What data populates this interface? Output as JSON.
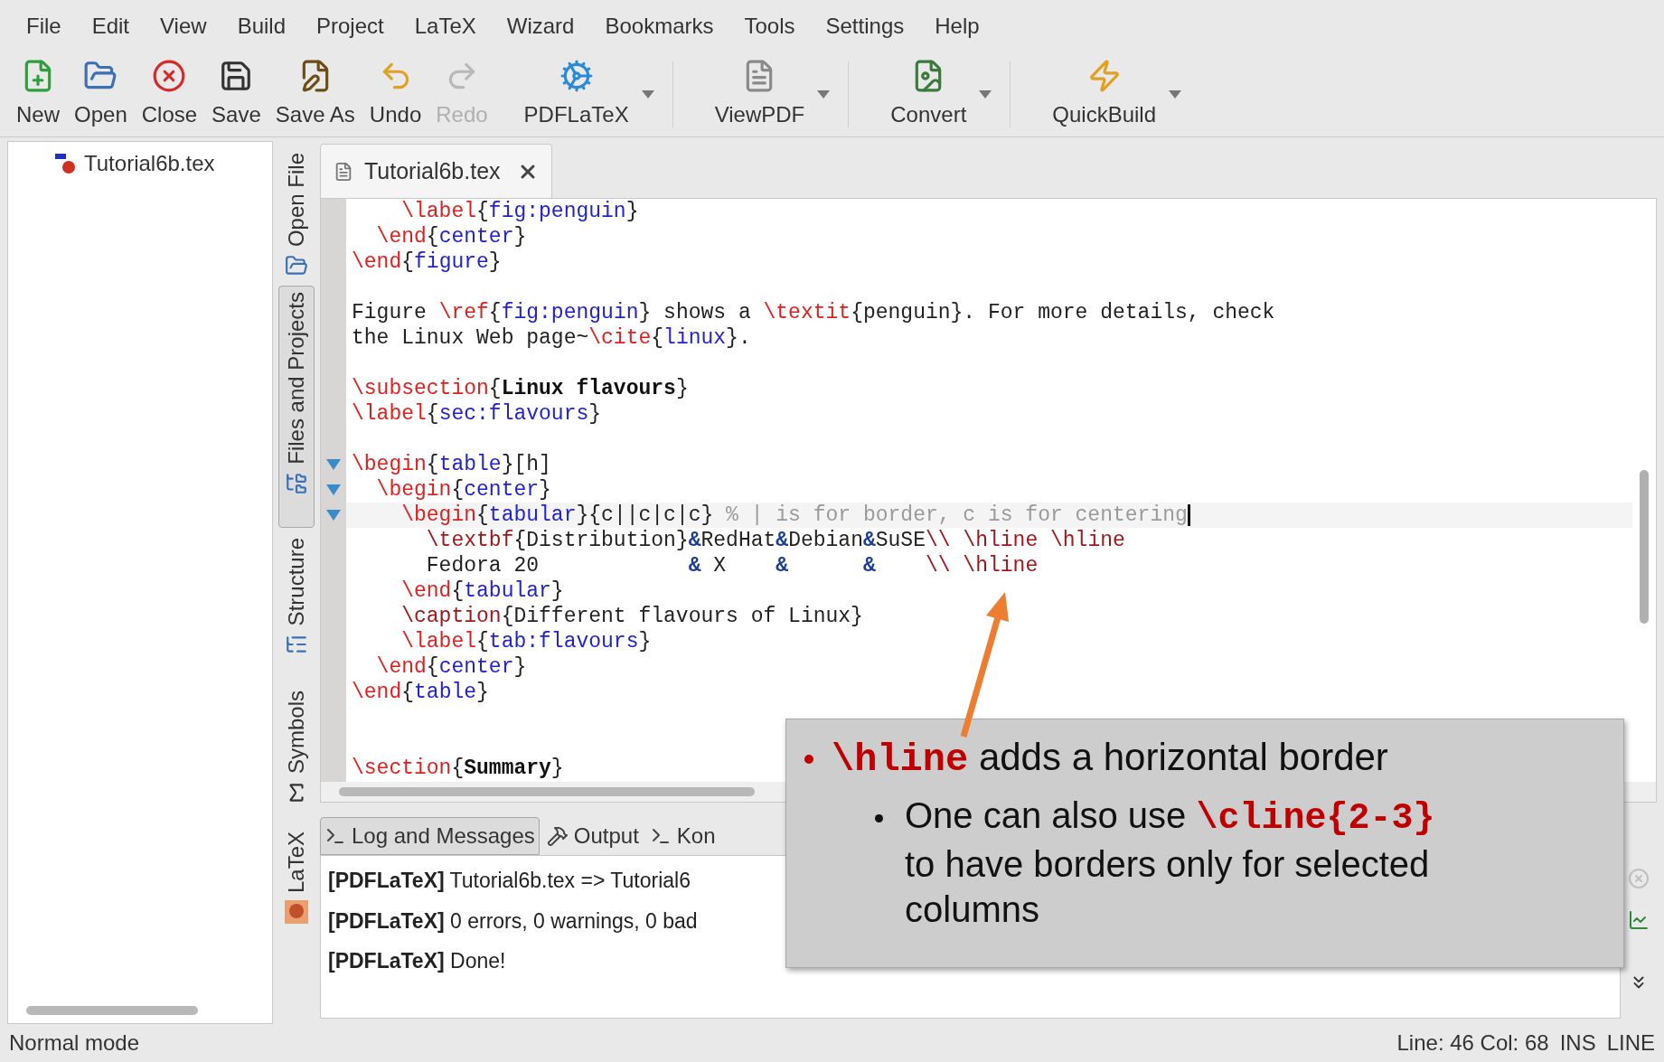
{
  "menu": [
    "File",
    "Edit",
    "View",
    "Build",
    "Project",
    "LaTeX",
    "Wizard",
    "Bookmarks",
    "Tools",
    "Settings",
    "Help"
  ],
  "toolbar": [
    {
      "label": "New",
      "disabled": false,
      "dropdown": false,
      "separator_after": false
    },
    {
      "label": "Open",
      "disabled": false,
      "dropdown": false,
      "separator_after": false
    },
    {
      "label": "Close",
      "disabled": false,
      "dropdown": false,
      "separator_after": false
    },
    {
      "label": "Save",
      "disabled": false,
      "dropdown": false,
      "separator_after": false
    },
    {
      "label": "Save As",
      "disabled": false,
      "dropdown": false,
      "separator_after": false
    },
    {
      "label": "Undo",
      "disabled": false,
      "dropdown": false,
      "separator_after": false
    },
    {
      "label": "Redo",
      "disabled": true,
      "dropdown": false,
      "separator_after": false
    },
    {
      "label": "PDFLaTeX",
      "disabled": false,
      "dropdown": true,
      "separator_after": true
    },
    {
      "label": "ViewPDF",
      "disabled": false,
      "dropdown": true,
      "separator_after": true
    },
    {
      "label": "Convert",
      "disabled": false,
      "dropdown": true,
      "separator_after": true
    },
    {
      "label": "QuickBuild",
      "disabled": false,
      "dropdown": true,
      "separator_after": false
    }
  ],
  "file_tree": {
    "items": [
      {
        "label": "Tutorial6b.tex"
      }
    ]
  },
  "side_tabs": [
    {
      "label": "Open File",
      "selected": false
    },
    {
      "label": "Files and Projects",
      "selected": true
    },
    {
      "label": "Structure",
      "selected": false
    },
    {
      "label": "Symbols",
      "selected": false
    },
    {
      "label": "LaTeX",
      "selected": false
    }
  ],
  "editor": {
    "tabs": [
      {
        "label": "Tutorial6b.tex",
        "selected": true
      }
    ],
    "lines": [
      {
        "fold": false,
        "current": false,
        "tokens": [
          {
            "text": "    \\label",
            "kind": "cmd"
          },
          {
            "text": "{",
            "kind": "plain"
          },
          {
            "text": "fig:penguin",
            "kind": "arg"
          },
          {
            "text": "}",
            "kind": "plain"
          }
        ]
      },
      {
        "fold": false,
        "current": false,
        "tokens": [
          {
            "text": "  \\end",
            "kind": "cmd"
          },
          {
            "text": "{",
            "kind": "plain"
          },
          {
            "text": "center",
            "kind": "arg"
          },
          {
            "text": "}",
            "kind": "plain"
          }
        ]
      },
      {
        "fold": false,
        "current": false,
        "tokens": [
          {
            "text": "\\end",
            "kind": "cmd"
          },
          {
            "text": "{",
            "kind": "plain"
          },
          {
            "text": "figure",
            "kind": "arg"
          },
          {
            "text": "}",
            "kind": "plain"
          }
        ]
      },
      {
        "fold": false,
        "current": false
      },
      {
        "fold": false,
        "current": false,
        "tokens": [
          {
            "text": "Figure ",
            "kind": "plain"
          },
          {
            "text": "\\ref",
            "kind": "cmd"
          },
          {
            "text": "{",
            "kind": "plain"
          },
          {
            "text": "fig:penguin",
            "kind": "arg"
          },
          {
            "text": "} shows a ",
            "kind": "plain"
          },
          {
            "text": "\\textit",
            "kind": "cmd"
          },
          {
            "text": "{penguin}. For more details, check",
            "kind": "plain"
          }
        ]
      },
      {
        "fold": false,
        "current": false,
        "tokens": [
          {
            "text": "the Linux Web page~",
            "kind": "plain"
          },
          {
            "text": "\\cite",
            "kind": "cmd"
          },
          {
            "text": "{",
            "kind": "plain"
          },
          {
            "text": "linux",
            "kind": "arg"
          },
          {
            "text": "}.",
            "kind": "plain"
          }
        ]
      },
      {
        "fold": false,
        "current": false
      },
      {
        "fold": false,
        "current": false,
        "tokens": [
          {
            "text": "\\subsection",
            "kind": "cmd"
          },
          {
            "text": "{",
            "kind": "plain"
          },
          {
            "text": "Linux flavours",
            "kind": "bold"
          },
          {
            "text": "}",
            "kind": "plain"
          }
        ]
      },
      {
        "fold": false,
        "current": false,
        "tokens": [
          {
            "text": "\\label",
            "kind": "cmd"
          },
          {
            "text": "{",
            "kind": "plain"
          },
          {
            "text": "sec:flavours",
            "kind": "arg"
          },
          {
            "text": "}",
            "kind": "plain"
          }
        ]
      },
      {
        "fold": false,
        "current": false
      },
      {
        "fold": true,
        "current": false,
        "tokens": [
          {
            "text": "\\begin",
            "kind": "cmd"
          },
          {
            "text": "{",
            "kind": "plain"
          },
          {
            "text": "table",
            "kind": "arg"
          },
          {
            "text": "}[h]",
            "kind": "plain"
          }
        ]
      },
      {
        "fold": true,
        "current": false,
        "tokens": [
          {
            "text": "  \\begin",
            "kind": "cmd"
          },
          {
            "text": "{",
            "kind": "plain"
          },
          {
            "text": "center",
            "kind": "arg"
          },
          {
            "text": "}",
            "kind": "plain"
          }
        ]
      },
      {
        "fold": true,
        "current": true,
        "tokens": [
          {
            "text": "    \\begin",
            "kind": "cmd"
          },
          {
            "text": "{",
            "kind": "plain"
          },
          {
            "text": "tabular",
            "kind": "arg"
          },
          {
            "text": "}{c||c|c|c} ",
            "kind": "plain"
          },
          {
            "text": "% | is for border, c is for centering",
            "kind": "comment"
          }
        ]
      },
      {
        "fold": false,
        "current": false,
        "tokens": [
          {
            "text": "      \\textbf",
            "kind": "break"
          },
          {
            "text": "{Distribution}",
            "kind": "plain"
          },
          {
            "text": "&",
            "kind": "amp"
          },
          {
            "text": "RedHat",
            "kind": "plain"
          },
          {
            "text": "&",
            "kind": "amp"
          },
          {
            "text": "Debian",
            "kind": "plain"
          },
          {
            "text": "&",
            "kind": "amp"
          },
          {
            "text": "SuSE",
            "kind": "plain"
          },
          {
            "text": "\\\\ \\hline \\hline",
            "kind": "break"
          }
        ]
      },
      {
        "fold": false,
        "current": false,
        "tokens": [
          {
            "text": "      Fedora 20            ",
            "kind": "plain"
          },
          {
            "text": "&",
            "kind": "amp"
          },
          {
            "text": " X    ",
            "kind": "plain"
          },
          {
            "text": "&",
            "kind": "amp"
          },
          {
            "text": "      &",
            "kind": "amp"
          },
          {
            "text": "    \\\\ \\hline",
            "kind": "break"
          }
        ]
      },
      {
        "fold": false,
        "current": false,
        "tokens": [
          {
            "text": "    \\end",
            "kind": "cmd"
          },
          {
            "text": "{",
            "kind": "plain"
          },
          {
            "text": "tabular",
            "kind": "arg"
          },
          {
            "text": "}",
            "kind": "plain"
          }
        ]
      },
      {
        "fold": false,
        "current": false,
        "tokens": [
          {
            "text": "    \\caption",
            "kind": "break"
          },
          {
            "text": "{Different flavours of Linux}",
            "kind": "plain"
          }
        ]
      },
      {
        "fold": false,
        "current": false,
        "tokens": [
          {
            "text": "    \\label",
            "kind": "cmd"
          },
          {
            "text": "{",
            "kind": "plain"
          },
          {
            "text": "tab:flavours",
            "kind": "arg"
          },
          {
            "text": "}",
            "kind": "plain"
          }
        ]
      },
      {
        "fold": false,
        "current": false,
        "tokens": [
          {
            "text": "  \\end",
            "kind": "cmd"
          },
          {
            "text": "{",
            "kind": "plain"
          },
          {
            "text": "center",
            "kind": "arg"
          },
          {
            "text": "}",
            "kind": "plain"
          }
        ]
      },
      {
        "fold": false,
        "current": false,
        "tokens": [
          {
            "text": "\\end",
            "kind": "cmd"
          },
          {
            "text": "{",
            "kind": "plain"
          },
          {
            "text": "table",
            "kind": "arg"
          },
          {
            "text": "}",
            "kind": "plain"
          }
        ]
      },
      {
        "fold": false,
        "current": false
      },
      {
        "fold": false,
        "current": false
      },
      {
        "fold": false,
        "current": false,
        "tokens": [
          {
            "text": "\\section",
            "kind": "cmd"
          },
          {
            "text": "{",
            "kind": "plain"
          },
          {
            "text": "Summary",
            "kind": "bold"
          },
          {
            "text": "}",
            "kind": "plain"
          }
        ]
      }
    ]
  },
  "bottom_panel": {
    "tabs": [
      {
        "label": "Log and Messages",
        "selected": true
      },
      {
        "label": "Output",
        "selected": false
      },
      {
        "label": "Kon",
        "selected": false
      }
    ],
    "messages": [
      "**[PDFLaTeX]** Tutorial6b.tex => Tutorial6",
      "**[PDFLaTeX]** 0 errors, 0 warnings, 0 bad",
      "**[PDFLaTeX]** Done!"
    ]
  },
  "status_bar": {
    "mode": "Normal mode",
    "position": "Line: 46 Col: 68",
    "insert": "INS",
    "selection": "LINE"
  },
  "callout": {
    "code": "\\hline",
    "text": "adds a horizontal border",
    "children": [
      {
        "before": "One can also use",
        "code": "\\cline{2-3}",
        "after": "to have borders only for selected columns"
      }
    ]
  }
}
